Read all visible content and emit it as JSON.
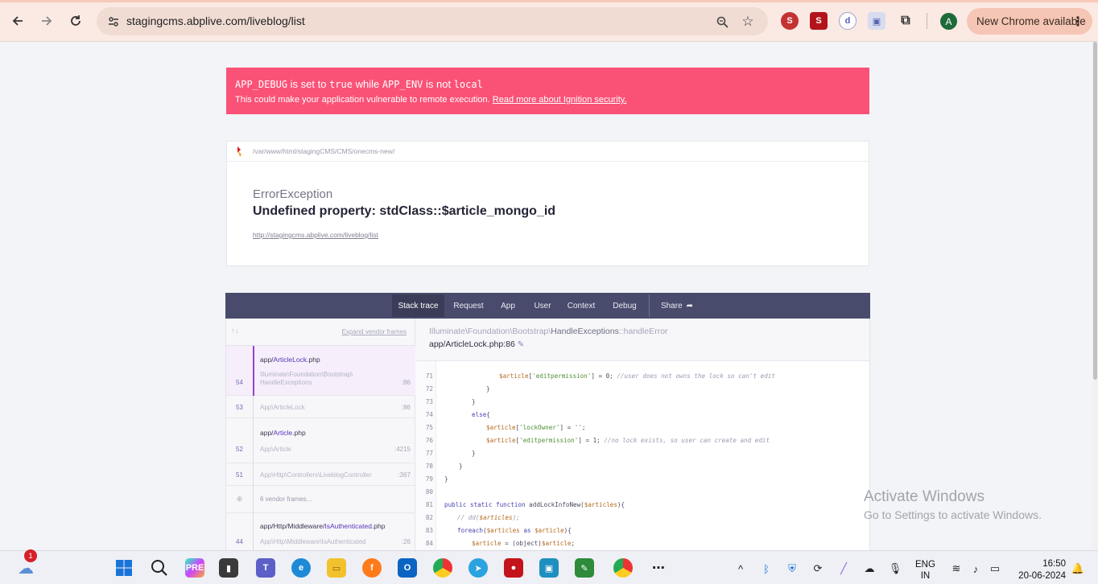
{
  "browser": {
    "url": "stagingcms.abplive.com/liveblog/list",
    "new_chrome": "New Chrome available",
    "profile_initial": "A"
  },
  "alert": {
    "app_debug": "APP_DEBUG",
    "is_set_to": " is set to ",
    "true_val": "true",
    "while": " while ",
    "app_env": "APP_ENV",
    "is_not": " is not ",
    "local_val": "local",
    "line2": "This could make your application vulnerable to remote execution.",
    "link": "Read more about Ignition security."
  },
  "error": {
    "path": "/var/www/html/stagingCMS/CMS/onecms-new/",
    "exception": "ErrorException",
    "message": "Undefined property: stdClass::$article_mongo_id",
    "url": "http://stagingcms.abplive.com/liveblog/list"
  },
  "tabs": [
    "Stack trace",
    "Request",
    "App",
    "User",
    "Context",
    "Debug",
    "Share"
  ],
  "frames": {
    "expand": "Expand vendor frames",
    "items": [
      {
        "file_prefix": "app/",
        "file_name": "ArticleLock",
        "file_ext": ".php",
        "num": "54",
        "cls1": "Illuminate\\Foundation\\Bootstrap\\",
        "cls2": "HandleExceptions",
        "line": ":86"
      },
      {
        "num": "53",
        "cls": "App\\ArticleLock",
        "line": ":86"
      },
      {
        "file_prefix": "app/",
        "file_name": "Article",
        "file_ext": ".php",
        "num": "52",
        "cls": "App\\Article",
        "line": ":4215"
      },
      {
        "num": "51",
        "cls": "App\\Http\\Controllers\\LiveblogController",
        "line": ":367"
      },
      {
        "vendor": "6 vendor frames..."
      },
      {
        "file_prefix": "app/Http/Middleware/",
        "file_name": "IsAuthenticated",
        "file_ext": ".php",
        "num": "44",
        "cls": "App\\Http\\Middleware\\IsAuthenticated",
        "line": ":26"
      }
    ]
  },
  "code": {
    "cls_prefix": "Illuminate\\Foundation\\Bootstrap\\",
    "cls_name": "HandleExceptions",
    "cls_method": "::handleError",
    "location": "app/ArticleLock.php:86",
    "lines": [
      {
        "n": "71",
        "text": "$article['editpermission'] = 0; //user does not owns the lock so can't edit"
      },
      {
        "n": "72",
        "text": "}"
      },
      {
        "n": "73",
        "text": "}"
      },
      {
        "n": "74",
        "text": "else{"
      },
      {
        "n": "75",
        "text": "$article['lockOwner'] = '';"
      },
      {
        "n": "76",
        "text": "$article['editpermission'] = 1; //no lock exists, so user can create and edit"
      },
      {
        "n": "77",
        "text": "}"
      },
      {
        "n": "78",
        "text": "}"
      },
      {
        "n": "79",
        "text": "}"
      },
      {
        "n": "80",
        "text": ""
      },
      {
        "n": "81",
        "text": "public static function addLockInfoNew($articles){"
      },
      {
        "n": "82",
        "text": "// dd($articles);"
      },
      {
        "n": "83",
        "text": "foreach($articles as $article){"
      },
      {
        "n": "84",
        "text": "$article = (object)$article;"
      }
    ]
  },
  "watermark": {
    "title": "Activate Windows",
    "subtitle": "Go to Settings to activate Windows."
  },
  "taskbar": {
    "weather_badge": "1",
    "lang1": "ENG",
    "lang2": "IN",
    "time": "16:50",
    "date": "20-06-2024"
  }
}
